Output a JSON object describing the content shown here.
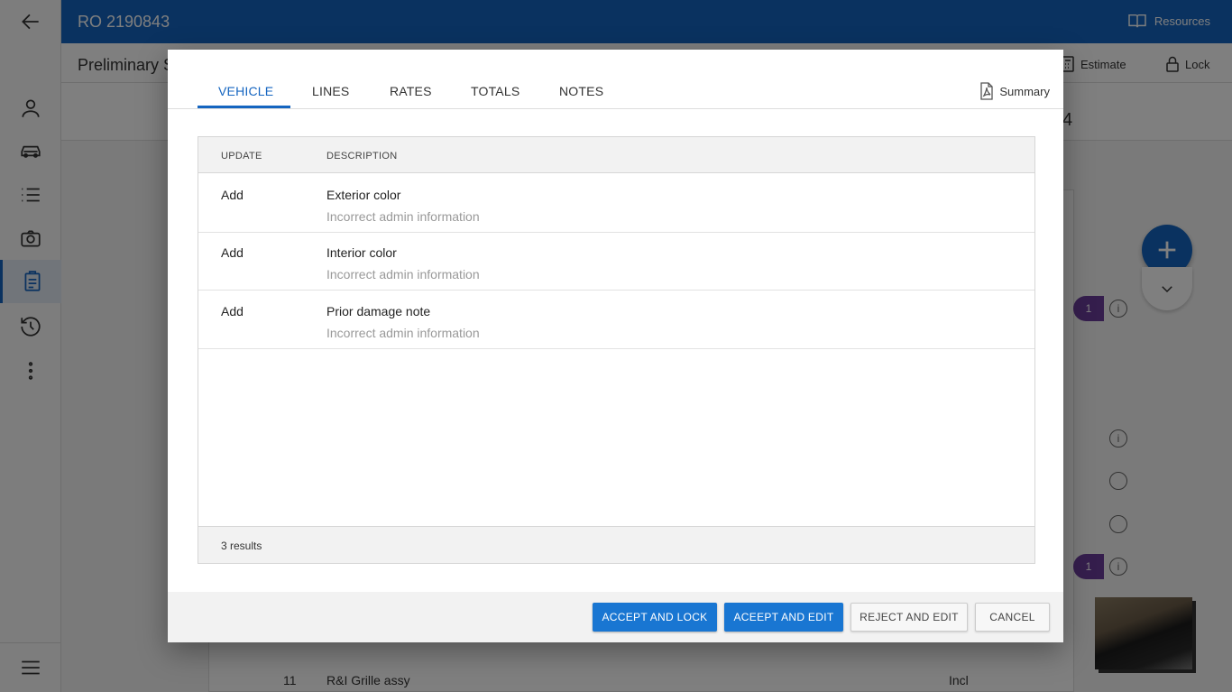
{
  "app": {
    "title": "RO 2190843",
    "resources_label": "Resources",
    "subtitle": "Preliminary S",
    "estimate_label": "Estimate",
    "lock_label": "Lock",
    "strip_number": "4",
    "background_row": {
      "line": "11",
      "description": "R&I Grille assy",
      "value": "Incl"
    },
    "badge_count": "1",
    "sidebar_items": [
      "back-arrow",
      "customer",
      "vehicle",
      "lines-list",
      "photos",
      "estimate-clipboard",
      "history",
      "more-options"
    ]
  },
  "dialog": {
    "tabs": [
      {
        "label": "VEHICLE",
        "active": true
      },
      {
        "label": "LINES",
        "active": false
      },
      {
        "label": "RATES",
        "active": false
      },
      {
        "label": "TOTALS",
        "active": false
      },
      {
        "label": "NOTES",
        "active": false
      }
    ],
    "summary_label": "Summary",
    "columns": {
      "update": "UPDATE",
      "description": "DESCRIPTION"
    },
    "rows": [
      {
        "update": "Add",
        "description": "Exterior color",
        "reason": "Incorrect admin information"
      },
      {
        "update": "Add",
        "description": "Interior color",
        "reason": "Incorrect admin information"
      },
      {
        "update": "Add",
        "description": "Prior damage note",
        "reason": "Incorrect admin information"
      }
    ],
    "results_text": "3 results",
    "buttons": {
      "accept_lock": "ACCEPT AND LOCK",
      "accept_edit": "ACEEPT AND EDIT",
      "reject_edit": "REJECT AND EDIT",
      "cancel": "CANCEL"
    }
  },
  "colors": {
    "primary": "#1565c0",
    "button_primary": "#1976d2",
    "badge": "#6a3d9a"
  }
}
